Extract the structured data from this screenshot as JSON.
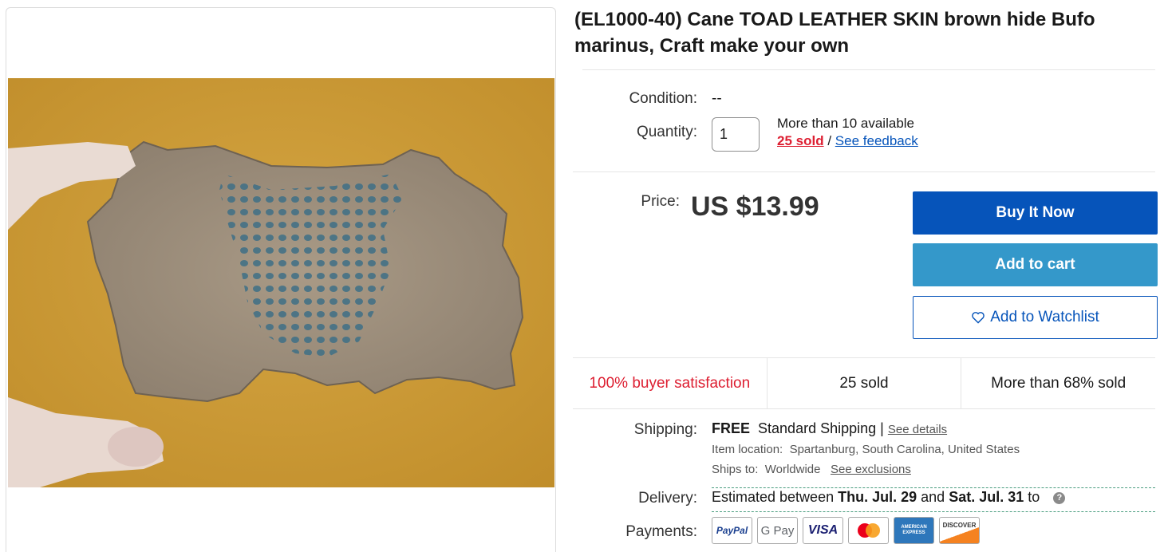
{
  "listing": {
    "title": "(EL1000-40) Cane TOAD LEATHER SKIN brown hide Bufo marinus, Craft make your own"
  },
  "condition": {
    "label": "Condition:",
    "value": "--"
  },
  "quantity": {
    "label": "Quantity:",
    "value": "1",
    "available": "More than 10 available",
    "sold_link": "25 sold",
    "separator": "/",
    "feedback_link": "See feedback"
  },
  "price": {
    "label": "Price:",
    "value": "US $13.99"
  },
  "actions": {
    "buy_now": "Buy It Now",
    "add_to_cart": "Add to cart",
    "watchlist": "Add to Watchlist"
  },
  "stats": {
    "satisfaction": "100% buyer satisfaction",
    "sold": "25 sold",
    "percent_sold": "More than 68% sold"
  },
  "shipping": {
    "label": "Shipping:",
    "free": "FREE",
    "method": "Standard Shipping",
    "separator": "|",
    "details_link": "See details",
    "location_label": "Item location:",
    "location": "Spartanburg, South Carolina, United States",
    "ships_to_label": "Ships to:",
    "ships_to": "Worldwide",
    "exclusions_link": "See exclusions"
  },
  "delivery": {
    "label": "Delivery:",
    "prefix": "Estimated between",
    "start": "Thu. Jul. 29",
    "and": "and",
    "end": "Sat. Jul. 31",
    "suffix": "to"
  },
  "payments": {
    "label": "Payments:",
    "methods": [
      "PayPal",
      "G Pay",
      "VISA",
      "",
      "AMERICAN EXPRESS",
      "DISCOVER"
    ]
  },
  "colors": {
    "brand_blue": "#0654ba",
    "cart_blue": "#3498ca",
    "accent_red": "#dd1e31"
  }
}
